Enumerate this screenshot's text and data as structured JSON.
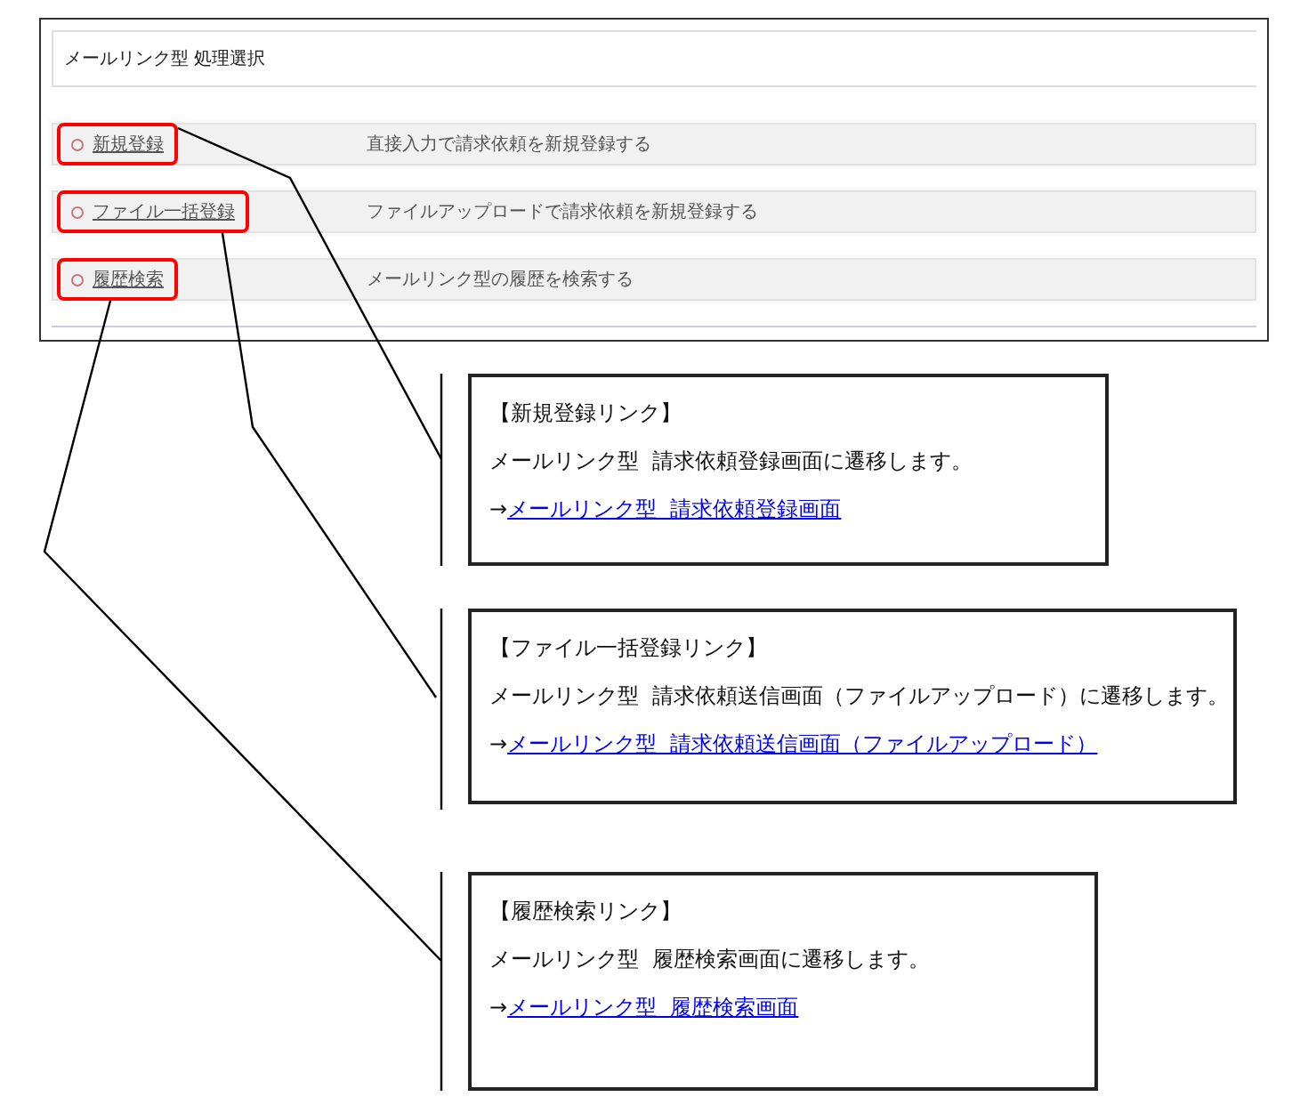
{
  "screen": {
    "title": "メールリンク型 処理選択",
    "rows": [
      {
        "link": "新規登録",
        "description": "直接入力で請求依頼を新規登録する",
        "highlighted": true
      },
      {
        "link": "ファイル一括登録",
        "description": "ファイルアップロードで請求依頼を新規登録する",
        "highlighted": true
      },
      {
        "link": "履歴検索",
        "description": "メールリンク型の履歴を検索する",
        "highlighted": true
      }
    ]
  },
  "callouts": [
    {
      "heading": "【新規登録リンク】",
      "text": "メールリンク型  請求依頼登録画面に遷移します。",
      "arrow": "→",
      "link": "メールリンク型  請求依頼登録画面"
    },
    {
      "heading": "【ファイル一括登録リンク】",
      "text": "メールリンク型  請求依頼送信画面（ファイルアップロード）に遷移します。",
      "arrow": "→",
      "link": "メールリンク型  請求依頼送信画面（ファイルアップロード）"
    },
    {
      "heading": "【履歴検索リンク】",
      "text": "メールリンク型  履歴検索画面に遷移します。",
      "arrow": "→",
      "link": "メールリンク型  履歴検索画面"
    }
  ]
}
